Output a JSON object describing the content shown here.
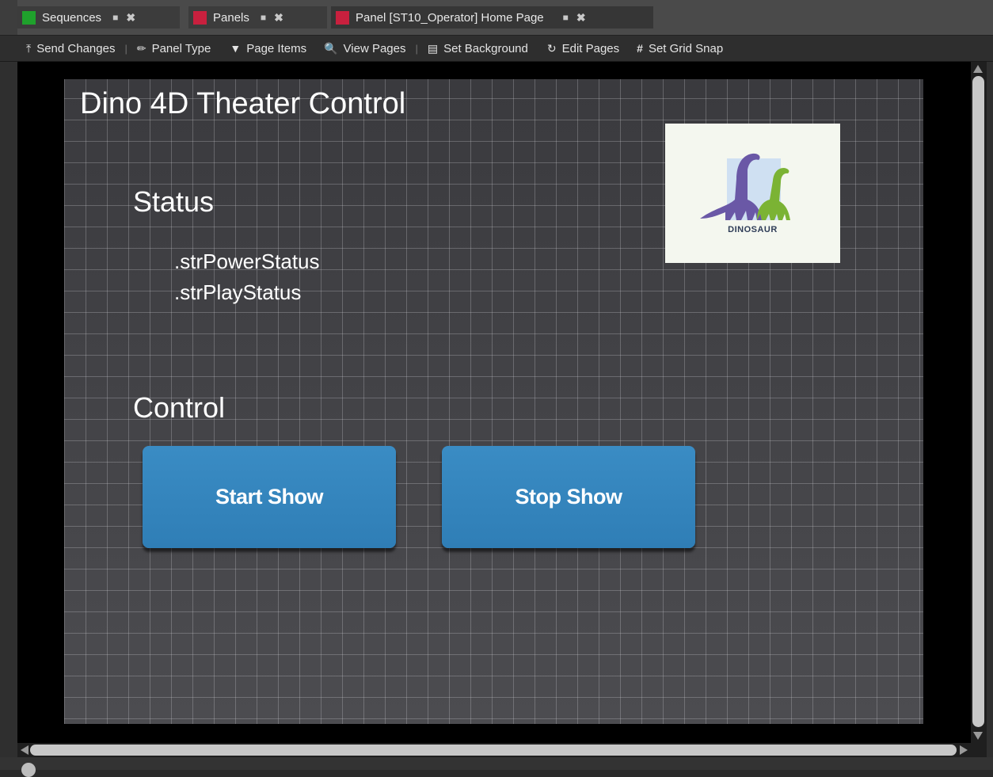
{
  "tabs": [
    {
      "label": "Sequences",
      "color": "#1fa12c"
    },
    {
      "label": "Panels",
      "color": "#c8203e"
    },
    {
      "label": "Panel [ST10_Operator] Home Page",
      "color": "#c8203e"
    }
  ],
  "toolbar": {
    "send_changes": "Send Changes",
    "panel_type": "Panel Type",
    "page_items": "Page Items",
    "view_pages": "View Pages",
    "set_background": "Set Background",
    "edit_pages": "Edit Pages",
    "set_grid_snap": "Set Grid Snap"
  },
  "panel": {
    "title": "Dino 4D Theater Control",
    "status_heading": "Status",
    "power_status": ".strPowerStatus",
    "play_status": ".strPlayStatus",
    "control_heading": "Control",
    "start_button": "Start Show",
    "stop_button": "Stop Show",
    "logo_text": "DINOSAUR",
    "button_color": "#3486bd"
  }
}
